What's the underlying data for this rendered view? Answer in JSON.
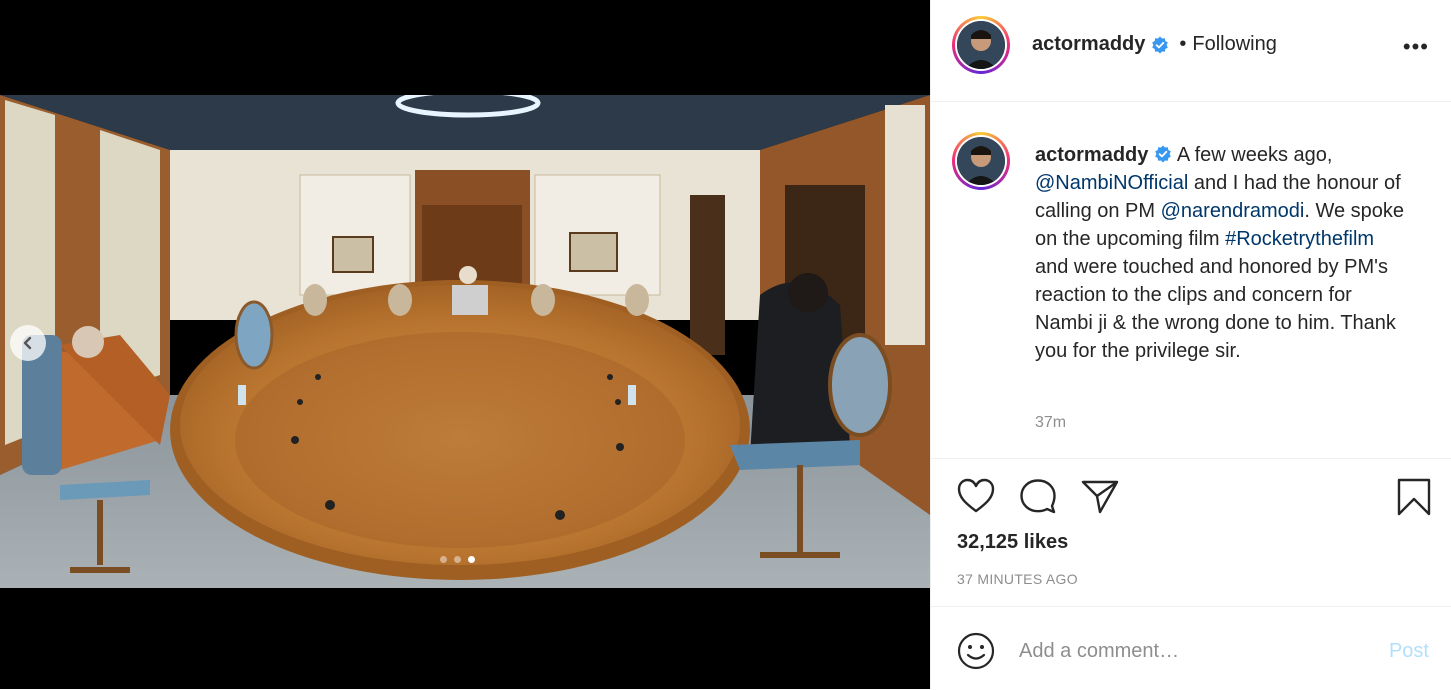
{
  "post": {
    "username": "actormaddy",
    "follow_sep": "•",
    "follow_state": "Following",
    "more_label": "•••",
    "caption": {
      "username": "actormaddy",
      "part1": " A few weeks ago, ",
      "mention1": "@NambiNOfficial",
      "part2": " and I had the honour of calling on PM ",
      "mention2": "@narendramodi",
      "part3": ". We spoke on the upcoming film ",
      "hashtag": "#Rocketrythefilm",
      "part4": " and were touched and honored by PM's reaction to the clips and concern for Nambi ji & the wrong done to him. Thank you for the privilege sir."
    },
    "caption_time": "37m",
    "likes": "32,125 likes",
    "posted_ago": "37 MINUTES AGO",
    "comment_placeholder": "Add a comment…",
    "post_label": "Post"
  },
  "carousel": {
    "count": 3,
    "active_index": 2
  },
  "colors": {
    "link": "#00376b",
    "post_disabled": "#b2dffc",
    "verified": "#3897f0",
    "muted": "#8e8e8e"
  },
  "icons": [
    "chevron-left-icon",
    "verified-badge-icon",
    "more-icon",
    "heart-icon",
    "comment-icon",
    "share-icon",
    "bookmark-icon",
    "emoji-icon"
  ]
}
